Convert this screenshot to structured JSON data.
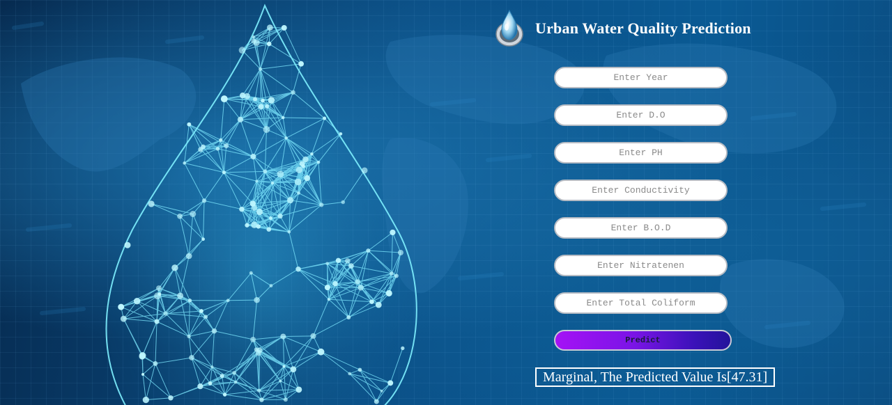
{
  "app": {
    "title": "Urban Water Quality Prediction",
    "logo_icon": "water-drop-logo-icon"
  },
  "form": {
    "fields": [
      {
        "name": "year",
        "placeholder": "Enter Year",
        "value": ""
      },
      {
        "name": "do",
        "placeholder": "Enter D.O",
        "value": ""
      },
      {
        "name": "ph",
        "placeholder": "Enter PH",
        "value": ""
      },
      {
        "name": "conductivity",
        "placeholder": "Enter Conductivity",
        "value": ""
      },
      {
        "name": "bod",
        "placeholder": "Enter B.O.D",
        "value": ""
      },
      {
        "name": "nitratenen",
        "placeholder": "Enter Nitratenen",
        "value": ""
      },
      {
        "name": "total_coliform",
        "placeholder": "Enter Total Coliform",
        "value": ""
      }
    ],
    "predict_label": "Predict"
  },
  "result": {
    "text": "Marginal, The Predicted Value Is[47.31]"
  },
  "colors": {
    "background_dark": "#062a4f",
    "background_light": "#0b5a94",
    "droplet_network": "#5ee6ff",
    "button_gradient_start": "#a512f5",
    "button_gradient_end": "#23139a",
    "title_text": "#ffffff"
  }
}
